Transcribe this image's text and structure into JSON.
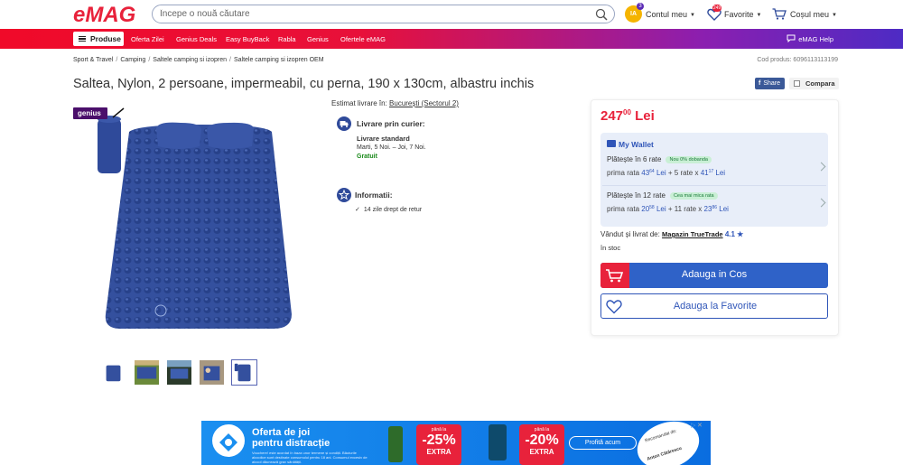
{
  "header": {
    "logo_text": "eMAG",
    "search_placeholder": "Începe o nouă căutare",
    "account_initials": "IA",
    "account_badge": "3",
    "account_label": "Contul meu",
    "favorites_badge": "249",
    "favorites_label": "Favorite",
    "cart_label": "Coșul meu"
  },
  "nav": {
    "produse": "Produse",
    "items": [
      "Oferta Zilei",
      "Genius Deals",
      "Easy BuyBack",
      "Rabla",
      "Genius",
      "Ofertele eMAG"
    ],
    "help": "eMAG Help"
  },
  "breadcrumb": [
    "Sport & Travel",
    "Camping",
    "Saltele camping si izopren",
    "Saltele camping si izopren OEM"
  ],
  "product_code": "Cod produs: 6096113113199",
  "title": "Saltea, Nylon, 2 persoane, impermeabil, cu perna, 190 x 130cm, albastru inchis",
  "share_label": "Share",
  "compare_label": "Compara",
  "genius_tag": "genius",
  "delivery": {
    "estimate_label": "Estimat livrare în:",
    "estimate_location": "București (Sectorul 2)",
    "courier_title": "Livrare prin curier:",
    "standard_title": "Livrare standard",
    "standard_dates": "Marti, 5 Noi. – Joi, 7 Noi.",
    "standard_price": "Gratuit",
    "info_title": "Informatii:",
    "return_text": "14 zile drept de retur"
  },
  "price": {
    "integer": "247",
    "decimals": "00",
    "currency": "Lei"
  },
  "wallet": {
    "title": "My Wallet",
    "plan1_title": "Plătește în 6 rate",
    "plan1_badge": "Nou 0% dobanda",
    "plan1_prefix": "prima rata",
    "plan1_first_int": "43",
    "plan1_first_dec": "64",
    "plan1_middle": "+ 5 rate x",
    "plan1_rest_int": "41",
    "plan1_rest_dec": "17",
    "plan2_title": "Plătește în 12 rate",
    "plan2_badge": "Cea mai mica rata",
    "plan2_prefix": "prima rata",
    "plan2_first_int": "20",
    "plan2_first_dec": "58",
    "plan2_middle": "+ 11 rate x",
    "plan2_rest_int": "23",
    "plan2_rest_dec": "86",
    "lei": "Lei"
  },
  "seller": {
    "label": "Vândut și livrat de:",
    "name": "Magazin TrueTrade",
    "rating": "4.1 ★"
  },
  "stock": "în stoc",
  "buttons": {
    "add_to_cart": "Adauga in Cos",
    "add_to_fav": "Adauga la Favorite"
  },
  "ad": {
    "title_line1": "Oferta de joi",
    "title_line2": "pentru distracție",
    "small_print": "Vouchere! este acordat în baza unor termene și condiții. Băuturile alcoolice sunt destinate consumului pentru 18 ani. Consumul excesiv de alcool dăunează grav sănătății.",
    "promo1_pana": "până la",
    "promo1_pct": "-25%",
    "promo1_extra": "EXTRA",
    "promo2_pana": "până la",
    "promo2_pct": "-20%",
    "promo2_extra": "EXTRA",
    "cta": "Profită acum",
    "rec_label": "Recomandat de:",
    "rec_name": "Anton Cătărescu"
  },
  "colors": {
    "brand_red": "#e8223b",
    "brand_blue": "#2f62c8",
    "wallet_bg": "#e8eef9"
  }
}
